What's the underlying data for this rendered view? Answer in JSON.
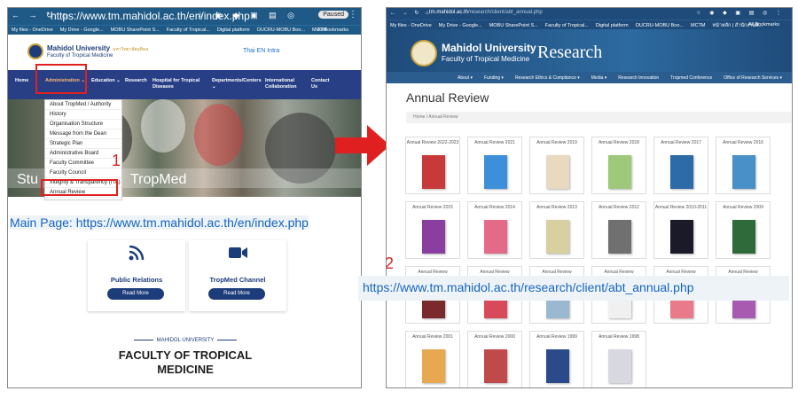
{
  "left_browser": {
    "url": "https://www.tm.mahidol.ac.th/en/index.php",
    "profile_label": "Paused",
    "bookmarks": [
      "My files - OneDrive",
      "My Drive - Google...",
      "MOBU SharePoint S...",
      "Faculty of Tropical...",
      "Digital platform",
      "OUCRU-MOBU Boo...",
      "MCTM"
    ],
    "bookmarks_end": "All Bookmarks",
    "site": {
      "name": "Mahidol University",
      "name_thai": "มหาวิทยาลัยมหิดล",
      "faculty": "Faculty of Tropical Medicine",
      "langs": "Thai  EN  Intra"
    },
    "nav": [
      {
        "label": "Home"
      },
      {
        "label": "Administration ⌄"
      },
      {
        "label": "Education ⌄"
      },
      {
        "label": "Research"
      },
      {
        "label": "Hospital for Tropical Diseases"
      },
      {
        "label": "Departments/Centers ⌄"
      },
      {
        "label": "International Collaboration"
      },
      {
        "label": "Contact Us"
      }
    ],
    "dropdown": [
      "About TropMed / Authority",
      "History",
      "Organisation Structure",
      "Message from the Dean",
      "Strategic Plan",
      "Administrative Board",
      "Faculty Committee",
      "Faculty Council",
      "Integrity & Transparency (ITA)",
      "Annual Review"
    ],
    "hero_left": "Stu",
    "hero_right": "TropMed",
    "cards": [
      {
        "icon": "rss-icon",
        "title": "Public Relations",
        "button": "Read More"
      },
      {
        "icon": "video-icon",
        "title": "TropMed Channel",
        "button": "Read More"
      }
    ],
    "faculty_small": "MAHIDOL UNIVERSITY",
    "faculty_big_1": "FACULTY OF TROPICAL",
    "faculty_big_2": "MEDICINE"
  },
  "annotation": {
    "main_label": "Main Page: https://www.tm.mahidol.ac.th/en/index.php",
    "step1": "1",
    "step2": "2",
    "target_url_label": "https://www.tm.mahidol.ac.th/research/client/abt_annual.php"
  },
  "right_browser": {
    "url_domain": "tm.mahidol.ac.th",
    "url_path": "/research/client/abt_annual.php",
    "bookmarks": [
      "My files - OneDrive",
      "My Drive - Google...",
      "MOBU SharePoint S...",
      "Faculty of Tropical...",
      "Digital platform",
      "OUCRU-MOBU Boo...",
      "MCTM",
      "หน้าหลัก | สำนักงานพั..."
    ],
    "bookmarks_end": "All Bookmarks",
    "header": {
      "name": "Mahidol University",
      "faculty": "Faculty of Tropical Medicine",
      "section": "Research"
    },
    "nav": [
      "About ▾",
      "Funding ▾",
      "Research Ethics & Compliance ▾",
      "Media ▾",
      "Research Innovation",
      "Tropmed Conference",
      "Office of Research Services ▾"
    ],
    "page_title": "Annual Review",
    "breadcrumb": "Home  /  Annual Review",
    "reviews": [
      {
        "label": "Annual Review 2022-2023",
        "color": "#c83a3a"
      },
      {
        "label": "Annual Review 2021",
        "color": "#3c8fd8"
      },
      {
        "label": "Annual Review 2019",
        "color": "#e8d9c0"
      },
      {
        "label": "Annual Review 2018",
        "color": "#9ec97a"
      },
      {
        "label": "Annual Review 2017",
        "color": "#2d6ba8"
      },
      {
        "label": "Annual Review 2016",
        "color": "#4a90c8"
      },
      {
        "label": "Annual Review 2015",
        "color": "#8a3fa0"
      },
      {
        "label": "Annual Review 2014",
        "color": "#e46a8a"
      },
      {
        "label": "Annual Review 2013",
        "color": "#d8d0a0"
      },
      {
        "label": "Annual Review 2012",
        "color": "#707070"
      },
      {
        "label": "Annual Review 2010-2011",
        "color": "#1a1a28"
      },
      {
        "label": "Annual Review 2009",
        "color": "#2f6a3a"
      },
      {
        "label": "Annual Review",
        "color": "#7a2a2a"
      },
      {
        "label": "Annual Review",
        "color": "#d84a5a"
      },
      {
        "label": "Annual Review",
        "color": "#9ab8d0"
      },
      {
        "label": "Annual Review",
        "color": "#f0f0f0"
      },
      {
        "label": "Annual Review",
        "color": "#e87a8a"
      },
      {
        "label": "Annual Review",
        "color": "#a85ab0"
      },
      {
        "label": "Annual Review 2001",
        "color": "#e8a850"
      },
      {
        "label": "Annual Review 2000",
        "color": "#c04a4a"
      },
      {
        "label": "Annual Review 1999",
        "color": "#2a4a8a"
      },
      {
        "label": "Annual Review 1998",
        "color": "#d8d8e0"
      }
    ]
  },
  "colors": {
    "brand_navy": "#1d3d7a",
    "highlight_red": "#e02020",
    "link_blue": "#1565c0"
  }
}
